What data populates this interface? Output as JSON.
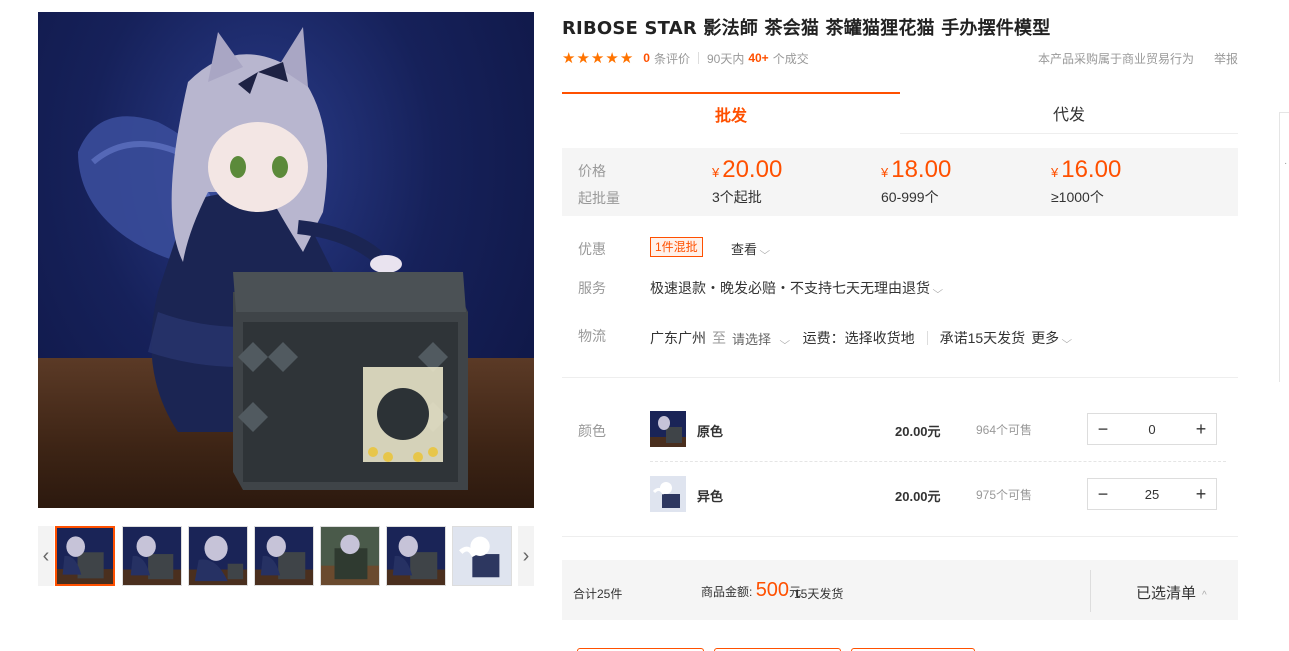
{
  "product": {
    "title": "RIBOSE STAR 影法師 茶会猫 茶罐猫狸花猫 手办摆件模型"
  },
  "rating": {
    "stars": 5,
    "review_count": "0",
    "review_label": "条评价",
    "period": "90天内",
    "sales": "40+",
    "sales_label": "个成交",
    "trade_note": "本产品采购属于商业贸易行为",
    "report": "举报"
  },
  "tabs": [
    "批发",
    "代发"
  ],
  "price_box": {
    "price_label": "价格",
    "moq_label": "起批量",
    "currency": "¥",
    "tiers": [
      {
        "price": "20.00",
        "qty": "3个起批"
      },
      {
        "price": "18.00",
        "qty": "60-999个"
      },
      {
        "price": "16.00",
        "qty": "≥1000个"
      }
    ]
  },
  "promo": {
    "label": "优惠",
    "tag": "1件混批",
    "view": "查看"
  },
  "service": {
    "label": "服务",
    "text": "极速退款・晚发必赔・不支持七天无理由退货"
  },
  "logistics": {
    "label": "物流",
    "from": "广东广州",
    "to": "至",
    "select": "请选择",
    "fee": "运费：选择收货地",
    "promise": "承诺15天发货",
    "more": "更多"
  },
  "sku": {
    "label": "颜色",
    "items": [
      {
        "name": "原色",
        "price": "20.00元",
        "stock": "964个可售",
        "qty": "0"
      },
      {
        "name": "异色",
        "price": "20.00元",
        "stock": "975个可售",
        "qty": "25"
      }
    ]
  },
  "summary": {
    "total": "合计25件",
    "amount_label": "商品金额:",
    "amount": "500",
    "unit": "元",
    "ship": "15天发货",
    "selected_list": "已选清单"
  },
  "colors": {
    "accent": "#ff5000",
    "star": "#ff7300",
    "panel": "#f5f5f5"
  },
  "icons": [
    "chevron-left-icon",
    "chevron-right-icon",
    "chevron-down-icon",
    "chevron-up-icon",
    "star-icon",
    "minus-icon",
    "plus-icon"
  ]
}
